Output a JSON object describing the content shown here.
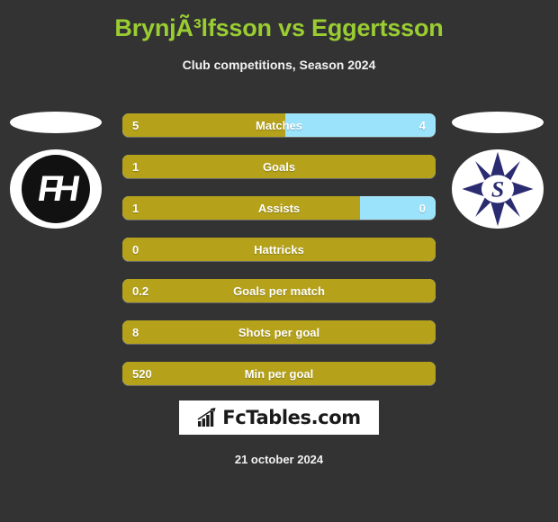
{
  "header": {
    "title": "BrynjÃ³lfsson vs Eggertsson",
    "subtitle": "Club competitions, Season 2024",
    "title_color": "#9ACD32"
  },
  "crests": {
    "home": {
      "name": "fh-club-crest",
      "monogram": "FH",
      "primary_color": "#111111",
      "background_color": "#FFFFFF"
    },
    "away": {
      "name": "star-club-crest",
      "monogram": "S",
      "primary_color": "#2B2B72",
      "background_color": "#FFFFFF"
    }
  },
  "colors": {
    "background": "#333333",
    "home_bar": "#B5A21A",
    "away_bar": "#9BE3FB"
  },
  "stats": [
    {
      "label": "Matches",
      "home": "5",
      "away": "4",
      "home_pct": 52,
      "away_shown": true
    },
    {
      "label": "Goals",
      "home": "1",
      "away": "",
      "home_pct": 100,
      "away_shown": false
    },
    {
      "label": "Assists",
      "home": "1",
      "away": "0",
      "home_pct": 76,
      "away_shown": true
    },
    {
      "label": "Hattricks",
      "home": "0",
      "away": "",
      "home_pct": 100,
      "away_shown": false
    },
    {
      "label": "Goals per match",
      "home": "0.2",
      "away": "",
      "home_pct": 100,
      "away_shown": false
    },
    {
      "label": "Shots per goal",
      "home": "8",
      "away": "",
      "home_pct": 100,
      "away_shown": false
    },
    {
      "label": "Min per goal",
      "home": "520",
      "away": "",
      "home_pct": 100,
      "away_shown": false
    }
  ],
  "footer": {
    "watermark_text": "FcTables.com",
    "watermark_icon": "bar-chart-growth-icon",
    "date": "21 october 2024"
  }
}
